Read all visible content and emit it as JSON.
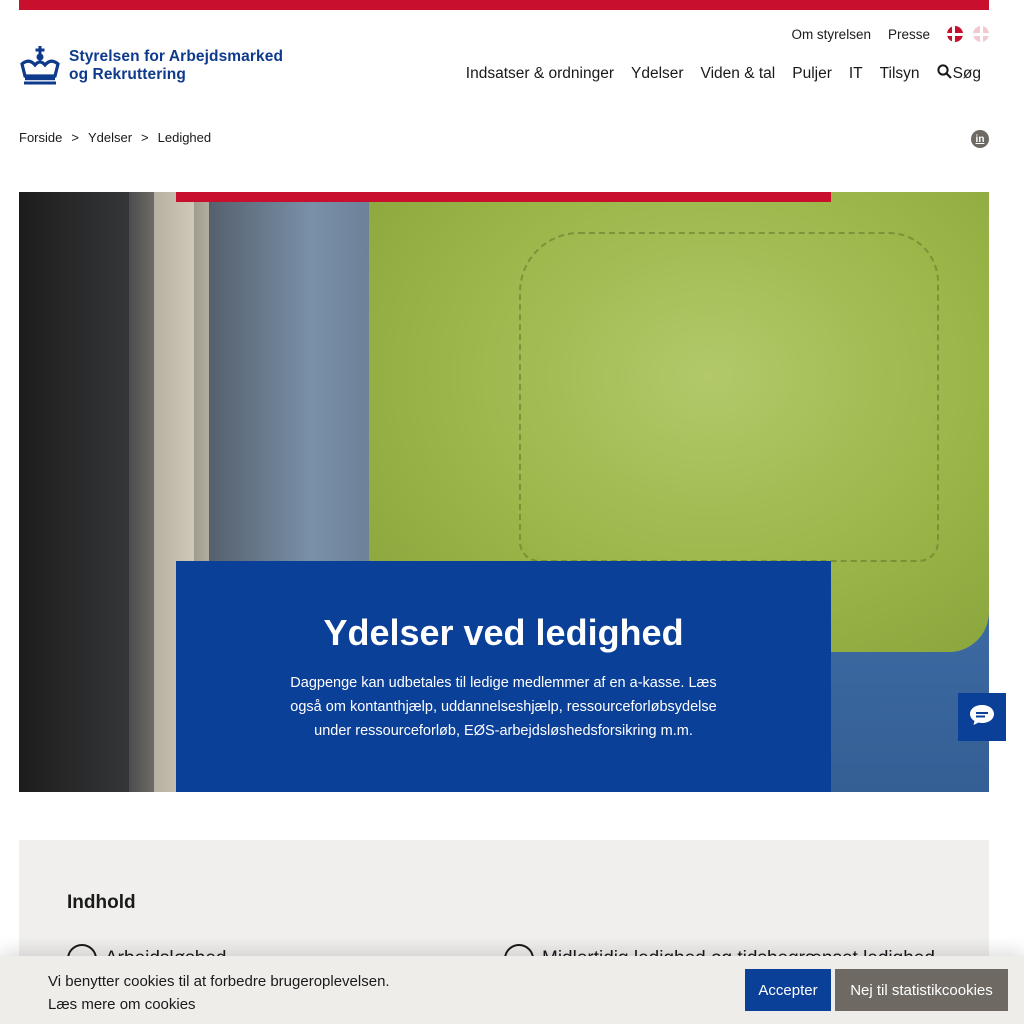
{
  "header": {
    "logo_line1": "Styrelsen for Arbejdsmarked",
    "logo_line2": "og Rekruttering",
    "util_nav": [
      "Om styrelsen",
      "Presse"
    ],
    "languages": [
      "da",
      "en"
    ],
    "main_nav": [
      "Indsatser & ordninger",
      "Ydelser",
      "Viden & tal",
      "Puljer",
      "IT",
      "Tilsyn"
    ],
    "search_label": "Søg",
    "brand_color": "#0e3a8c",
    "accent_color": "#c8102e"
  },
  "breadcrumb": {
    "items": [
      "Forside",
      "Ydelser",
      "Ledighed"
    ],
    "separator": ">"
  },
  "social": {
    "linkedin_label": "in"
  },
  "hero": {
    "title": "Ydelser ved ledighed",
    "text": "Dagpenge kan udbetales til ledige medlemmer af en a-kasse. Læs også om kontanthjælp, uddannelseshjælp, ressourceforløbsydelse under ressourceforløb, EØS-arbejdsløshedsforsikring m.m.",
    "box_color": "#0b4099"
  },
  "toc": {
    "title": "Indhold",
    "items": [
      "Arbejdsløshed",
      "Midlertidig ledighed og tidsbegrænset ledighed"
    ]
  },
  "cookie": {
    "message": "Vi benytter cookies til at forbedre brugeroplevelsen.",
    "read_more": "Læs mere om cookies",
    "accept_label": "Accepter",
    "decline_label": "Nej til statistikcookies"
  }
}
